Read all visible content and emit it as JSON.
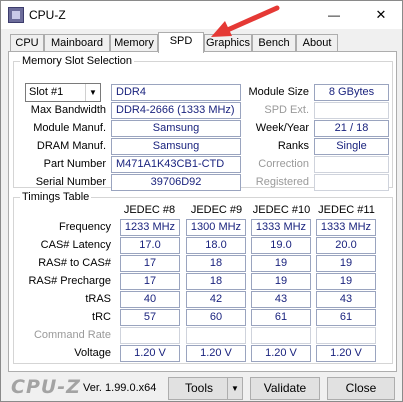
{
  "window": {
    "title": "CPU-Z",
    "minimize": "—",
    "close": "✕"
  },
  "tabs": [
    "CPU",
    "Mainboard",
    "Memory",
    "SPD",
    "Graphics",
    "Bench",
    "About"
  ],
  "active_tab": "SPD",
  "memory_slot": {
    "title": "Memory Slot Selection",
    "slot": "Slot #1",
    "type": "DDR4",
    "module_size_label": "Module Size",
    "module_size": "8 GBytes",
    "max_bandwidth_label": "Max Bandwidth",
    "max_bandwidth": "DDR4-2666 (1333 MHz)",
    "spd_ext_label": "SPD Ext.",
    "spd_ext": "",
    "module_manuf_label": "Module Manuf.",
    "module_manuf": "Samsung",
    "week_year_label": "Week/Year",
    "week_year": "21 / 18",
    "dram_manuf_label": "DRAM Manuf.",
    "dram_manuf": "Samsung",
    "ranks_label": "Ranks",
    "ranks": "Single",
    "part_number_label": "Part Number",
    "part_number": "M471A1K43CB1-CTD",
    "correction_label": "Correction",
    "correction": "",
    "serial_number_label": "Serial Number",
    "serial_number": "39706D92",
    "registered_label": "Registered",
    "registered": ""
  },
  "timings": {
    "title": "Timings Table",
    "columns": [
      "JEDEC #8",
      "JEDEC #9",
      "JEDEC #10",
      "JEDEC #11"
    ],
    "rows": [
      {
        "label": "Frequency",
        "values": [
          "1233 MHz",
          "1300 MHz",
          "1333 MHz",
          "1333 MHz"
        ]
      },
      {
        "label": "CAS# Latency",
        "values": [
          "17.0",
          "18.0",
          "19.0",
          "20.0"
        ]
      },
      {
        "label": "RAS# to CAS#",
        "values": [
          "17",
          "18",
          "19",
          "19"
        ]
      },
      {
        "label": "RAS# Precharge",
        "values": [
          "17",
          "18",
          "19",
          "19"
        ]
      },
      {
        "label": "tRAS",
        "values": [
          "40",
          "42",
          "43",
          "43"
        ]
      },
      {
        "label": "tRC",
        "values": [
          "57",
          "60",
          "61",
          "61"
        ]
      },
      {
        "label": "Command Rate",
        "values": [
          "",
          "",
          "",
          ""
        ]
      },
      {
        "label": "Voltage",
        "values": [
          "1.20 V",
          "1.20 V",
          "1.20 V",
          "1.20 V"
        ]
      }
    ]
  },
  "footer": {
    "brand": "CPU-Z",
    "version": "Ver. 1.99.0.x64",
    "tools": "Tools",
    "validate": "Validate",
    "close": "Close"
  },
  "colors": {
    "value_text": "#1a237e",
    "arrow": "#e53935"
  }
}
